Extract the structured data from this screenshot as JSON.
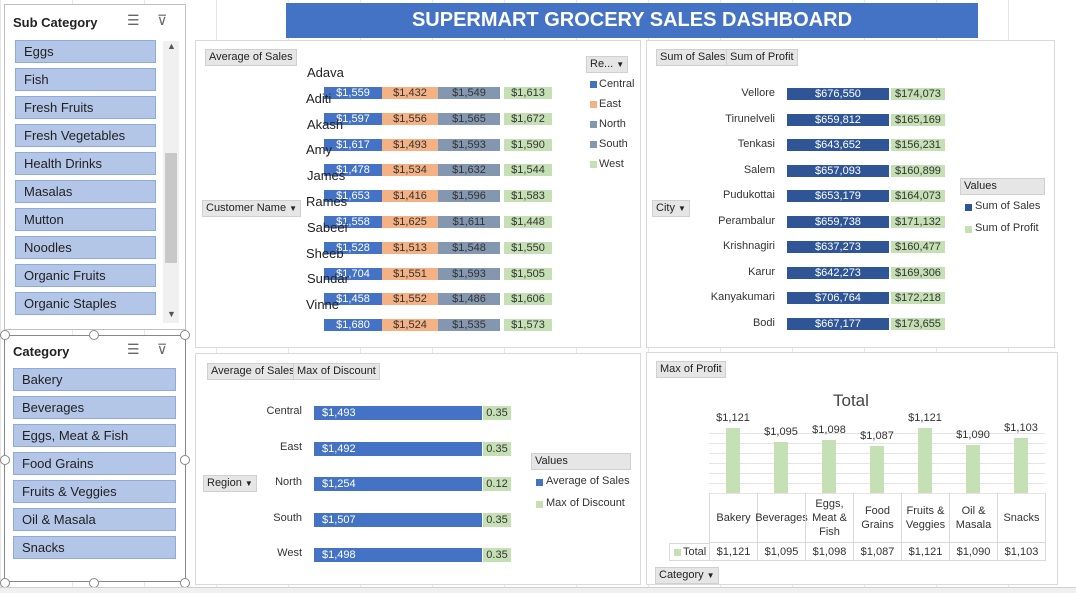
{
  "dashboard_title": "SUPERMART GROCERY SALES DASHBOARD",
  "colors": {
    "blue": "#4472c4",
    "orange": "#f4b183",
    "gray": "#8497b0",
    "green": "#a9d18e",
    "navy": "#2f5597",
    "lightgreen": "#c5e0b4"
  },
  "sub_category_slicer": {
    "title": "Sub Category",
    "items": [
      "Eggs",
      "Fish",
      "Fresh Fruits",
      "Fresh Vegetables",
      "Health Drinks",
      "Masalas",
      "Mutton",
      "Noodles",
      "Organic Fruits",
      "Organic Staples"
    ]
  },
  "category_slicer": {
    "title": "Category",
    "items": [
      "Bakery",
      "Beverages",
      "Eggs, Meat & Fish",
      "Food Grains",
      "Fruits & Veggies",
      "Oil & Masala",
      "Snacks"
    ]
  },
  "chart1": {
    "value_tag": "Average of Sales",
    "axis_tag": "Customer Name",
    "legend_tag": "Re...",
    "legend": [
      "Central",
      "East",
      "North",
      "South",
      "West"
    ],
    "customers": [
      {
        "name": "Adava",
        "values": [
          "$1,559",
          "$1,432",
          "$1,549",
          "$1,613"
        ]
      },
      {
        "name": "Aditi",
        "values": [
          "$1,597",
          "$1,556",
          "$1,565",
          "$1,672"
        ]
      },
      {
        "name": "Akash",
        "values": [
          "$1,617",
          "$1,493",
          "$1,593",
          "$1,590"
        ]
      },
      {
        "name": "Amy",
        "values": [
          "$1,478",
          "$1,534",
          "$1,632",
          "$1,544"
        ]
      },
      {
        "name": "James",
        "values": [
          "$1,653",
          "$1,416",
          "$1,596",
          "$1,583"
        ]
      },
      {
        "name": "Rames",
        "values": [
          "$1,558",
          "$1,625",
          "$1,611",
          "$1,448"
        ]
      },
      {
        "name": "Sabeel",
        "values": [
          "$1,528",
          "$1,513",
          "$1,548",
          "$1,550"
        ]
      },
      {
        "name": "Sheeb",
        "values": [
          "$1,704",
          "$1,551",
          "$1,593",
          "$1,505"
        ]
      },
      {
        "name": "Sundar",
        "values": [
          "$1,458",
          "$1,552",
          "$1,486",
          "$1,606"
        ]
      },
      {
        "name": "Vinne",
        "values": [
          "$1,680",
          "$1,524",
          "$1,535",
          "$1,573"
        ]
      }
    ]
  },
  "chart2": {
    "tag1": "Sum of Sales",
    "tag2": "Sum of Profit",
    "axis_tag": "City",
    "legend_title": "Values",
    "legend": [
      "Sum of Sales",
      "Sum of Profit"
    ],
    "cities": [
      {
        "name": "Vellore",
        "sales": "$676,550",
        "profit": "$174,073"
      },
      {
        "name": "Tirunelveli",
        "sales": "$659,812",
        "profit": "$165,169"
      },
      {
        "name": "Tenkasi",
        "sales": "$643,652",
        "profit": "$156,231"
      },
      {
        "name": "Salem",
        "sales": "$657,093",
        "profit": "$160,899"
      },
      {
        "name": "Pudukottai",
        "sales": "$653,179",
        "profit": "$164,073"
      },
      {
        "name": "Perambalur",
        "sales": "$659,738",
        "profit": "$171,132"
      },
      {
        "name": "Krishnagiri",
        "sales": "$637,273",
        "profit": "$160,477"
      },
      {
        "name": "Karur",
        "sales": "$642,273",
        "profit": "$169,306"
      },
      {
        "name": "Kanyakumari",
        "sales": "$706,764",
        "profit": "$172,218"
      },
      {
        "name": "Bodi",
        "sales": "$667,177",
        "profit": "$173,655"
      }
    ]
  },
  "chart3": {
    "tag1": "Average of Sales",
    "tag2": "Max of Discount",
    "axis_tag": "Region",
    "legend_title": "Values",
    "legend": [
      "Average of Sales",
      "Max of Discount"
    ],
    "regions": [
      {
        "name": "Central",
        "sales": "$1,493",
        "discount": "0.35"
      },
      {
        "name": "East",
        "sales": "$1,492",
        "discount": "0.35"
      },
      {
        "name": "North",
        "sales": "$1,254",
        "discount": "0.12"
      },
      {
        "name": "South",
        "sales": "$1,507",
        "discount": "0.35"
      },
      {
        "name": "West",
        "sales": "$1,498",
        "discount": "0.35"
      }
    ]
  },
  "chart4": {
    "tag": "Max of Profit",
    "title": "Total",
    "axis_tag": "Category",
    "total_label": "Total",
    "categories": [
      {
        "name": "Bakery",
        "value": 1121,
        "label": "$1,121"
      },
      {
        "name": "Beverages",
        "value": 1095,
        "label": "$1,095"
      },
      {
        "name": "Eggs, Meat & Fish",
        "value": 1098,
        "label": "$1,098"
      },
      {
        "name": "Food Grains",
        "value": 1087,
        "label": "$1,087"
      },
      {
        "name": "Fruits & Veggies",
        "value": 1121,
        "label": "$1,121"
      },
      {
        "name": "Oil & Masala",
        "value": 1090,
        "label": "$1,090"
      },
      {
        "name": "Snacks",
        "value": 1103,
        "label": "$1,103"
      }
    ]
  },
  "chart_data": [
    {
      "type": "bar",
      "title": "",
      "categories": [
        "Adava",
        "Aditi",
        "Akash",
        "Amy",
        "James",
        "Rames",
        "Sabeel",
        "Sheeb",
        "Sundar",
        "Vinne"
      ],
      "series": [
        {
          "name": "Central",
          "values": [
            1559,
            1597,
            1617,
            1478,
            1653,
            1558,
            1528,
            1704,
            1458,
            1680
          ]
        },
        {
          "name": "East",
          "values": [
            1432,
            1556,
            1493,
            1534,
            1416,
            1625,
            1513,
            1551,
            1552,
            1524
          ]
        },
        {
          "name": "North",
          "values": [
            1549,
            1565,
            1593,
            1632,
            1596,
            1611,
            1548,
            1593,
            1486,
            1535
          ]
        },
        {
          "name": "West",
          "values": [
            1613,
            1672,
            1590,
            1544,
            1583,
            1448,
            1550,
            1505,
            1606,
            1573
          ]
        }
      ]
    },
    {
      "type": "bar",
      "title": "",
      "categories": [
        "Vellore",
        "Tirunelveli",
        "Tenkasi",
        "Salem",
        "Pudukottai",
        "Perambalur",
        "Krishnagiri",
        "Karur",
        "Kanyakumari",
        "Bodi"
      ],
      "series": [
        {
          "name": "Sum of Sales",
          "values": [
            676550,
            659812,
            643652,
            657093,
            653179,
            659738,
            637273,
            642273,
            706764,
            667177
          ]
        },
        {
          "name": "Sum of Profit",
          "values": [
            174073,
            165169,
            156231,
            160899,
            164073,
            171132,
            160477,
            169306,
            172218,
            173655
          ]
        }
      ]
    },
    {
      "type": "bar",
      "title": "",
      "categories": [
        "Central",
        "East",
        "North",
        "South",
        "West"
      ],
      "series": [
        {
          "name": "Average of Sales",
          "values": [
            1493,
            1492,
            1254,
            1507,
            1498
          ]
        },
        {
          "name": "Max of Discount",
          "values": [
            0.35,
            0.35,
            0.12,
            0.35,
            0.35
          ]
        }
      ]
    },
    {
      "type": "bar",
      "title": "Total",
      "categories": [
        "Bakery",
        "Beverages",
        "Eggs, Meat & Fish",
        "Food Grains",
        "Fruits & Veggies",
        "Oil & Masala",
        "Snacks"
      ],
      "values": [
        1121,
        1095,
        1098,
        1087,
        1121,
        1090,
        1103
      ]
    }
  ]
}
